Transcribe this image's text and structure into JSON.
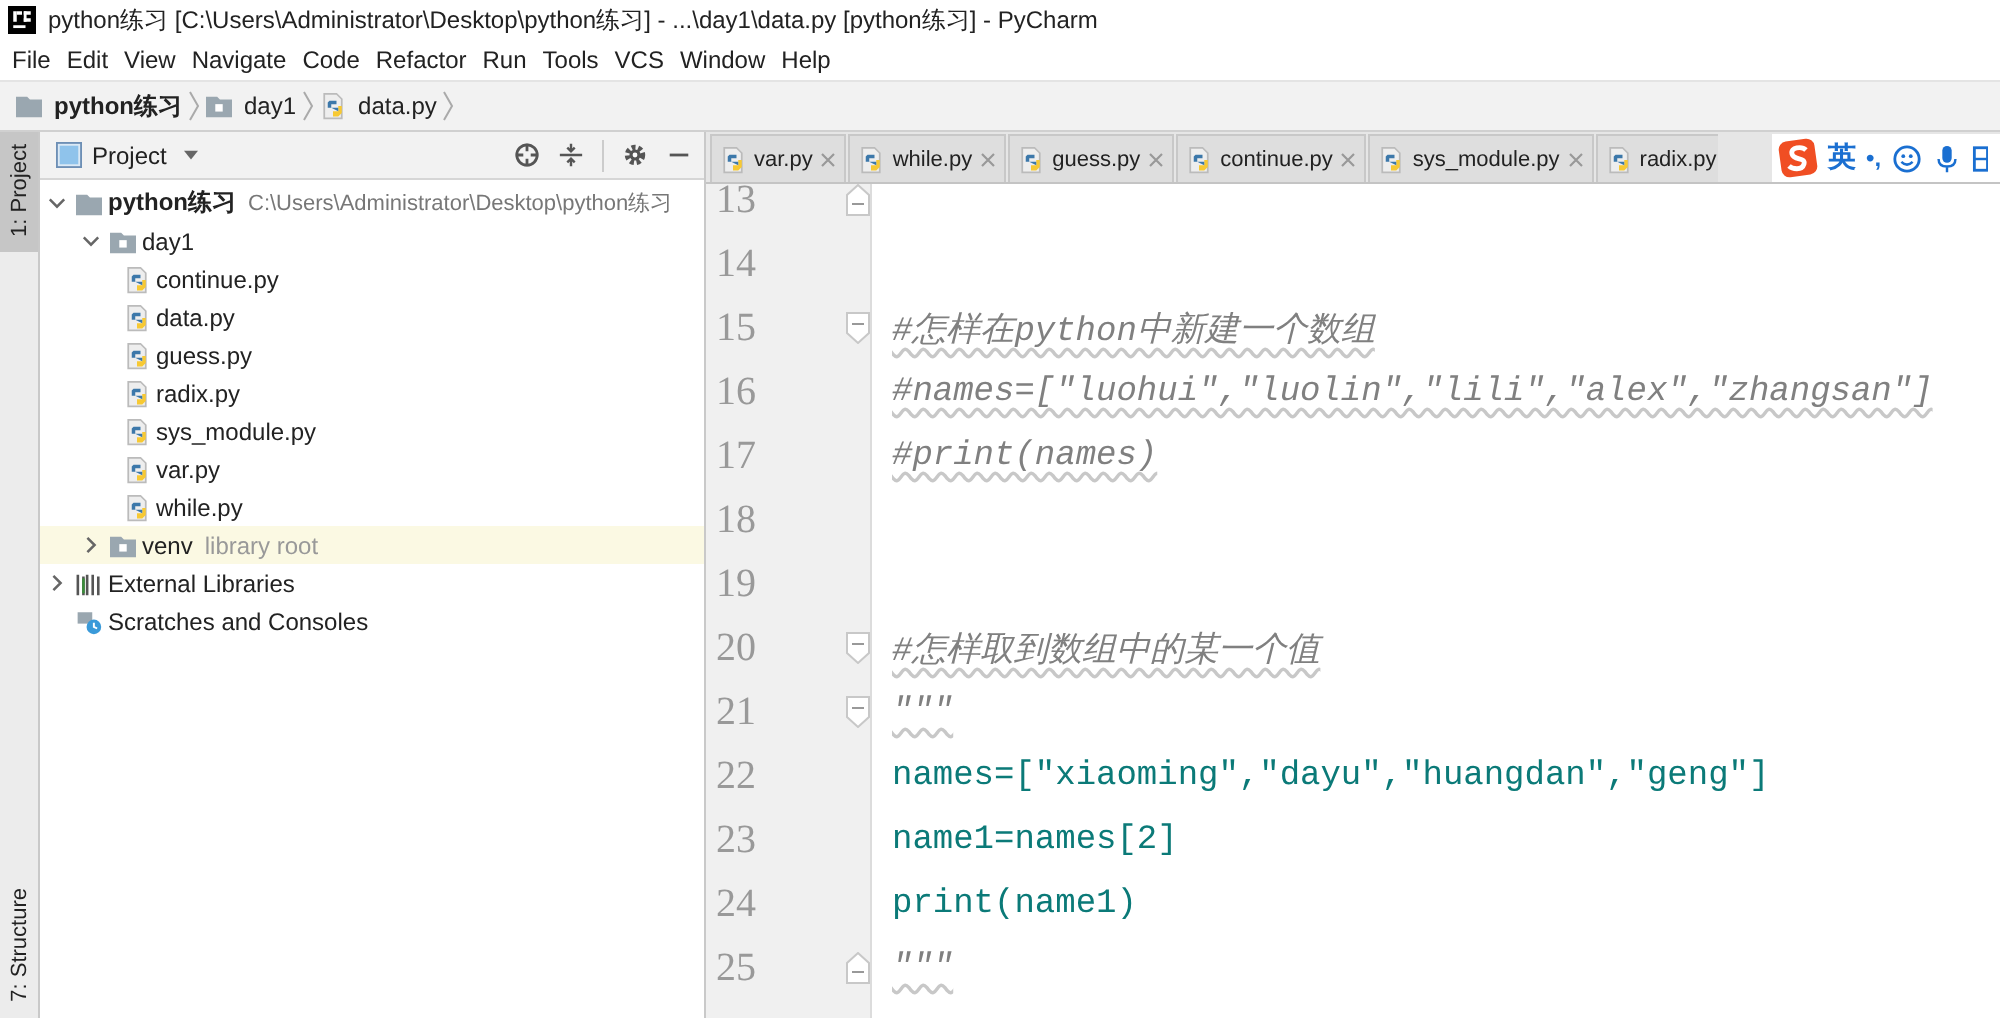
{
  "window": {
    "title": "python练习 [C:\\Users\\Administrator\\Desktop\\python练习] - ...\\day1\\data.py [python练习] - PyCharm"
  },
  "menu": [
    "File",
    "Edit",
    "View",
    "Navigate",
    "Code",
    "Refactor",
    "Run",
    "Tools",
    "VCS",
    "Window",
    "Help"
  ],
  "breadcrumb": [
    {
      "label": "python练习",
      "kind": "project"
    },
    {
      "label": "day1",
      "kind": "folder"
    },
    {
      "label": "data.py",
      "kind": "file"
    }
  ],
  "side_tabs_top": [
    {
      "label": "1: Project",
      "selected": true
    }
  ],
  "side_tabs_bottom": [
    {
      "label": "7: Structure",
      "selected": false
    }
  ],
  "project_panel": {
    "title": "Project",
    "tree": [
      {
        "label": "python练习",
        "path": "C:\\Users\\Administrator\\Desktop\\python练习",
        "kind": "project",
        "expanded": true,
        "children": [
          {
            "label": "day1",
            "kind": "folder",
            "expanded": true,
            "children": [
              {
                "label": "continue.py",
                "kind": "python"
              },
              {
                "label": "data.py",
                "kind": "python"
              },
              {
                "label": "guess.py",
                "kind": "python"
              },
              {
                "label": "radix.py",
                "kind": "python"
              },
              {
                "label": "sys_module.py",
                "kind": "python"
              },
              {
                "label": "var.py",
                "kind": "python"
              },
              {
                "label": "while.py",
                "kind": "python"
              }
            ]
          },
          {
            "label": "venv",
            "hint": "library root",
            "kind": "library",
            "expanded": false
          }
        ]
      },
      {
        "label": "External Libraries",
        "kind": "libraries",
        "expanded": false
      },
      {
        "label": "Scratches and Consoles",
        "kind": "scratches"
      }
    ]
  },
  "editor_tabs": [
    {
      "label": "var.py",
      "selected": false,
      "closable": true
    },
    {
      "label": "while.py",
      "selected": false,
      "closable": true
    },
    {
      "label": "guess.py",
      "selected": false,
      "closable": true
    },
    {
      "label": "continue.py",
      "selected": false,
      "closable": true
    },
    {
      "label": "sys_module.py",
      "selected": false,
      "closable": true
    },
    {
      "label": "radix.py",
      "selected": false,
      "closable": false
    }
  ],
  "code_lines": [
    {
      "number": "13",
      "kind": "blank",
      "fold_end": true
    },
    {
      "number": "14",
      "kind": "blank"
    },
    {
      "number": "15",
      "kind": "comment",
      "text": "#怎样在python中新建一个数组",
      "fold_start": true
    },
    {
      "number": "16",
      "kind": "comment",
      "text": "#names=[\"luohui\",\"luolin\",\"lili\",\"alex\",\"zhangsan\"]"
    },
    {
      "number": "17",
      "kind": "comment",
      "text": "#print(names)"
    },
    {
      "number": "18",
      "kind": "blank"
    },
    {
      "number": "19",
      "kind": "blank"
    },
    {
      "number": "20",
      "kind": "comment",
      "text": "#怎样取到数组中的某一个值",
      "fold_start": true
    },
    {
      "number": "21",
      "kind": "comment",
      "text": "\"\"\"",
      "fold_start": true
    },
    {
      "number": "22",
      "kind": "docstring",
      "text": "names=[\"xiaoming\",\"dayu\",\"huangdan\",\"geng\"]"
    },
    {
      "number": "23",
      "kind": "docstring",
      "text": "name1=names[2]"
    },
    {
      "number": "24",
      "kind": "docstring",
      "text": "print(name1)"
    },
    {
      "number": "25",
      "kind": "comment",
      "text": "\"\"\"",
      "fold_end": true
    }
  ],
  "ime_toolbar": {
    "language": "英",
    "punctuation": "•,"
  }
}
